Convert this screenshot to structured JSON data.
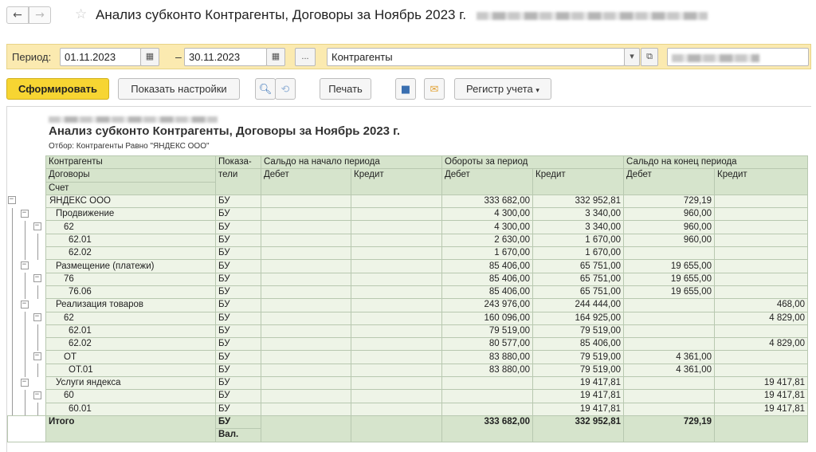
{
  "titlebar": {
    "back_icon": "arrow-left-icon",
    "forward_icon": "arrow-right-icon",
    "star_icon": "star-icon",
    "title": "Анализ субконто Контрагенты, Договоры за Ноябрь 2023 г."
  },
  "period_bar": {
    "label": "Период:",
    "date_from": "01.11.2023",
    "date_to": "30.11.2023",
    "dash": "–",
    "ellipsis": "...",
    "subconto": "Контрагенты"
  },
  "toolbar": {
    "generate": "Сформировать",
    "show_settings": "Показать настройки",
    "print": "Печать",
    "register": "Регистр учета"
  },
  "report": {
    "title": "Анализ субконто Контрагенты, Договоры за Ноябрь 2023 г.",
    "filter": "Отбор: Контрагенты Равно \"ЯНДЕКС ООО\"",
    "headers": {
      "counterparties": "Контрагенты",
      "contracts": "Договоры",
      "account": "Счет",
      "indicators_1": "Показа-",
      "indicators_2": "тели",
      "opening_balance": "Сальдо на начало периода",
      "turnover": "Обороты за период",
      "closing_balance": "Сальдо на конец периода",
      "debit": "Дебет",
      "credit": "Кредит"
    },
    "rows": [
      {
        "name": "ЯНДЕКС ООО",
        "ind": "БУ",
        "sd": "",
        "sc": "",
        "td": "333 682,00",
        "tc": "332 952,81",
        "ed": "729,19",
        "ec": ""
      },
      {
        "name": "Продвижение",
        "ind": "БУ",
        "sd": "",
        "sc": "",
        "td": "4 300,00",
        "tc": "3 340,00",
        "ed": "960,00",
        "ec": ""
      },
      {
        "name": "62",
        "ind": "БУ",
        "sd": "",
        "sc": "",
        "td": "4 300,00",
        "tc": "3 340,00",
        "ed": "960,00",
        "ec": ""
      },
      {
        "name": "62.01",
        "ind": "БУ",
        "sd": "",
        "sc": "",
        "td": "2 630,00",
        "tc": "1 670,00",
        "ed": "960,00",
        "ec": ""
      },
      {
        "name": "62.02",
        "ind": "БУ",
        "sd": "",
        "sc": "",
        "td": "1 670,00",
        "tc": "1 670,00",
        "ed": "",
        "ec": ""
      },
      {
        "name": "Размещение (платежи)",
        "ind": "БУ",
        "sd": "",
        "sc": "",
        "td": "85 406,00",
        "tc": "65 751,00",
        "ed": "19 655,00",
        "ec": ""
      },
      {
        "name": "76",
        "ind": "БУ",
        "sd": "",
        "sc": "",
        "td": "85 406,00",
        "tc": "65 751,00",
        "ed": "19 655,00",
        "ec": ""
      },
      {
        "name": "76.06",
        "ind": "БУ",
        "sd": "",
        "sc": "",
        "td": "85 406,00",
        "tc": "65 751,00",
        "ed": "19 655,00",
        "ec": ""
      },
      {
        "name": "Реализация товаров",
        "ind": "БУ",
        "sd": "",
        "sc": "",
        "td": "243 976,00",
        "tc": "244 444,00",
        "ed": "",
        "ec": "468,00"
      },
      {
        "name": "62",
        "ind": "БУ",
        "sd": "",
        "sc": "",
        "td": "160 096,00",
        "tc": "164 925,00",
        "ed": "",
        "ec": "4 829,00"
      },
      {
        "name": "62.01",
        "ind": "БУ",
        "sd": "",
        "sc": "",
        "td": "79 519,00",
        "tc": "79 519,00",
        "ed": "",
        "ec": ""
      },
      {
        "name": "62.02",
        "ind": "БУ",
        "sd": "",
        "sc": "",
        "td": "80 577,00",
        "tc": "85 406,00",
        "ed": "",
        "ec": "4 829,00"
      },
      {
        "name": "ОТ",
        "ind": "БУ",
        "sd": "",
        "sc": "",
        "td": "83 880,00",
        "tc": "79 519,00",
        "ed": "4 361,00",
        "ec": ""
      },
      {
        "name": "ОТ.01",
        "ind": "БУ",
        "sd": "",
        "sc": "",
        "td": "83 880,00",
        "tc": "79 519,00",
        "ed": "4 361,00",
        "ec": ""
      },
      {
        "name": "Услуги яндекса",
        "ind": "БУ",
        "sd": "",
        "sc": "",
        "td": "",
        "tc": "19 417,81",
        "ed": "",
        "ec": "19 417,81"
      },
      {
        "name": "60",
        "ind": "БУ",
        "sd": "",
        "sc": "",
        "td": "",
        "tc": "19 417,81",
        "ed": "",
        "ec": "19 417,81"
      },
      {
        "name": "60.01",
        "ind": "БУ",
        "sd": "",
        "sc": "",
        "td": "",
        "tc": "19 417,81",
        "ed": "",
        "ec": "19 417,81"
      }
    ],
    "total": {
      "name": "Итого",
      "ind": "БУ",
      "ind2": "Вал.",
      "sd": "",
      "sc": "",
      "td": "333 682,00",
      "tc": "332 952,81",
      "ed": "729,19",
      "ec": ""
    }
  }
}
